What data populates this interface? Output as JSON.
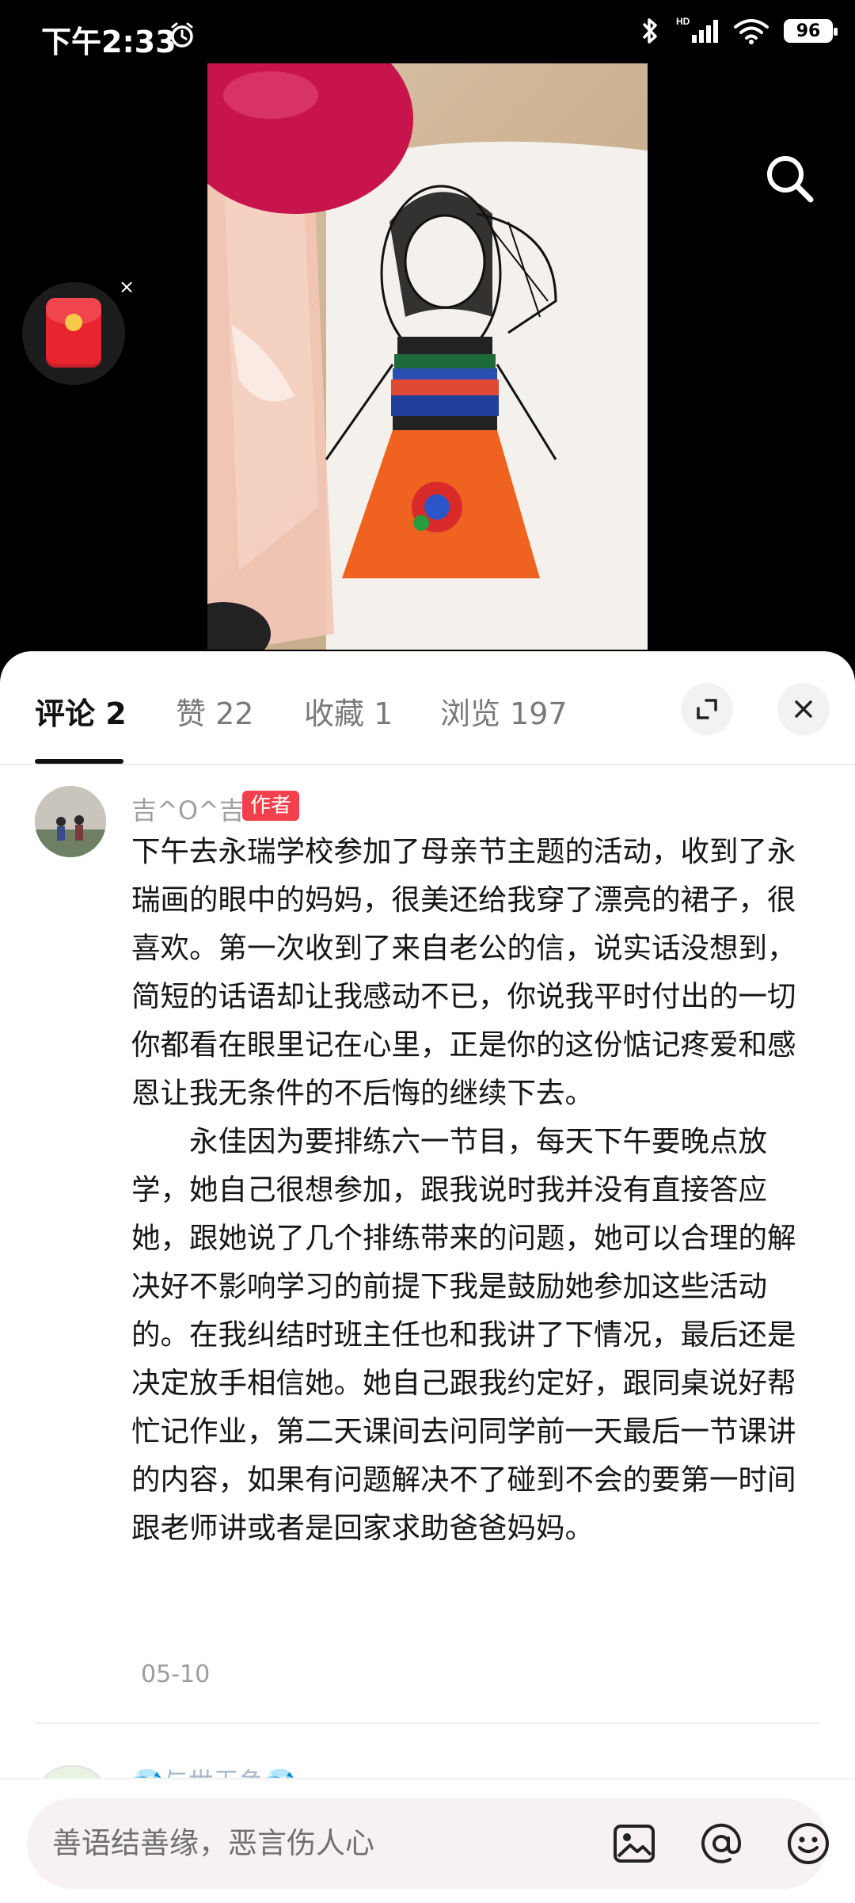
{
  "status_bar": {
    "time": "下午2:33",
    "battery": "96",
    "network_label": "HD"
  },
  "media": {
    "floating_close": "×"
  },
  "tabs": [
    {
      "label": "评论 2",
      "active": true
    },
    {
      "label": "赞 22",
      "active": false
    },
    {
      "label": "收藏 1",
      "active": false
    },
    {
      "label": "浏览 197",
      "active": false
    }
  ],
  "comment": {
    "username": "吉^O^吉",
    "tag": "作者",
    "paragraph1": "下午去永瑞学校参加了母亲节主题的活动，收到了永瑞画的眼中的妈妈，很美还给我穿了漂亮的裙子，很喜欢。第一次收到了来自老公的信，说实话没想到，简短的话语却让我感动不已，你说我平时付出的一切你都看在眼里记在心里，正是你的这份惦记疼爱和感恩让我无条件的不后悔的继续下去。",
    "paragraph2": "永佳因为要排练六一节目，每天下午要晚点放学，她自己很想参加，跟我说时我并没有直接答应她，跟她说了几个排练带来的问题，她可以合理的解决好不影响学习的前提下我是鼓励她参加这些活动的。在我纠结时班主任也和我讲了下情况，最后还是决定放手相信她。她自己跟我约定好，跟同桌说好帮忙记作业，第二天课间去问同学前一天最后一节课讲的内容，如果有问题解决不了碰到不会的要第一时间跟老师讲或者是回家求助爸爸妈妈。",
    "date": "05-10"
  },
  "next_comment": {
    "username": "💎与世无争💎"
  },
  "input": {
    "placeholder": "善语结善缘，恶言伤人心"
  },
  "colors": {
    "accent": "#f43f4c",
    "sheet_bg": "#ffffff",
    "input_bg": "#f7f1f3"
  }
}
